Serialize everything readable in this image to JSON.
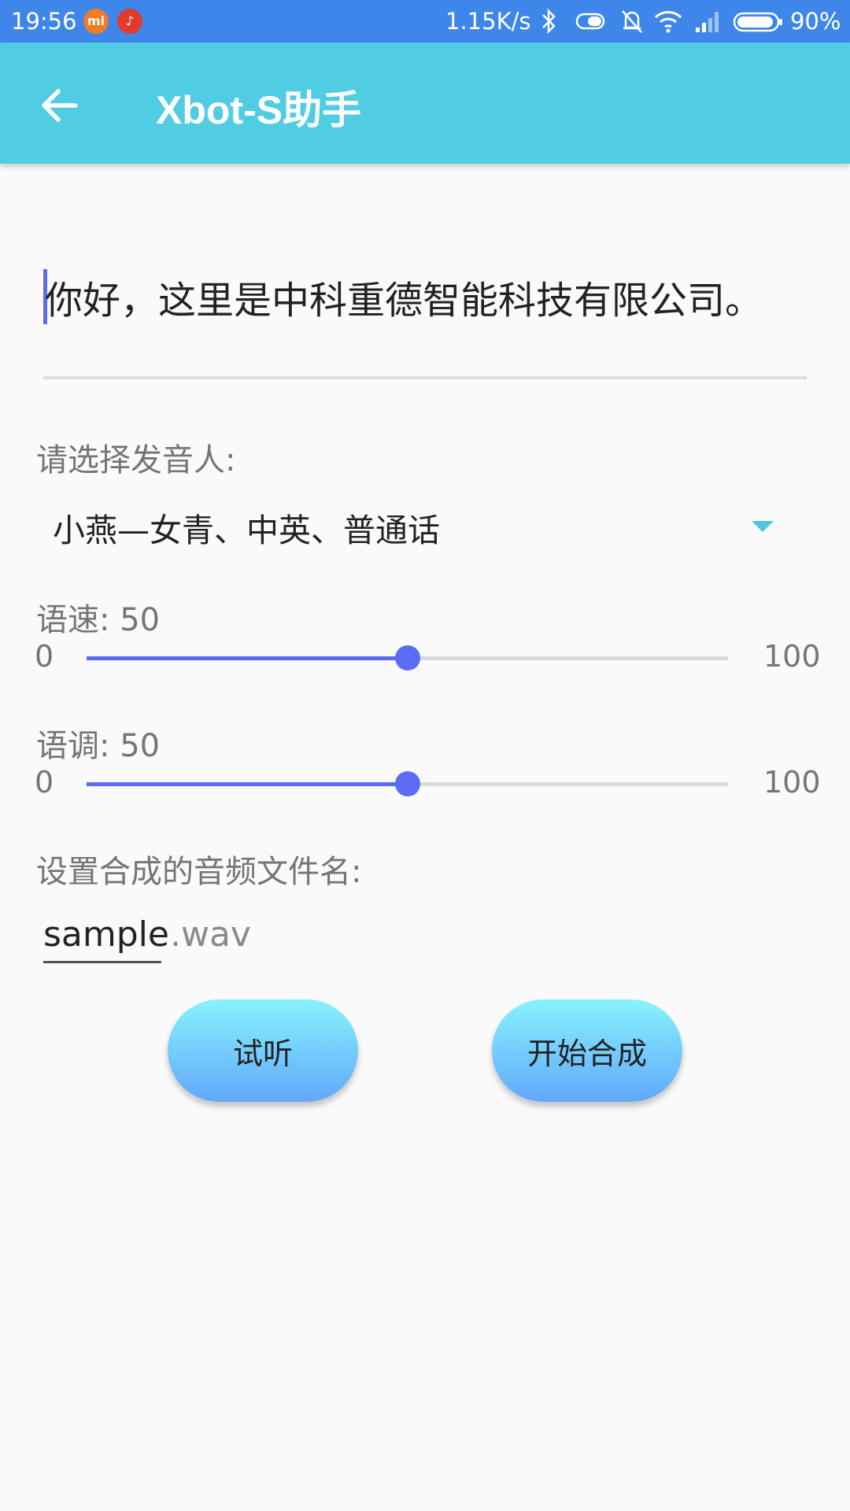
{
  "status_bar": {
    "time": "19:56",
    "network_speed": "1.15K/s",
    "battery": "90%",
    "icons": [
      "mi-app-icon",
      "netease-music-icon",
      "bluetooth-icon",
      "vibrate-icon",
      "mute-bell-icon",
      "wifi-icon",
      "signal-icon",
      "battery-icon"
    ]
  },
  "app_bar": {
    "title": "Xbot-S助手",
    "back_icon": "arrow-left-icon"
  },
  "text_input": {
    "value": "你好，这里是中科重德智能科技有限公司。"
  },
  "speaker": {
    "label": "请选择发音人:",
    "selected": "小燕—女青、中英、普通话"
  },
  "speed": {
    "label": "语速: 50",
    "min": "0",
    "max": "100",
    "value": 50
  },
  "pitch": {
    "label": "语调: 50",
    "min": "0",
    "max": "100",
    "value": 50
  },
  "filename": {
    "label": "设置合成的音频文件名:",
    "value": "sample",
    "extension": ".wav"
  },
  "buttons": {
    "listen": "试听",
    "start": "开始合成"
  },
  "colors": {
    "status_bar": "#3f86ea",
    "app_bar": "#51cde3",
    "accent": "#5a6cf3"
  }
}
